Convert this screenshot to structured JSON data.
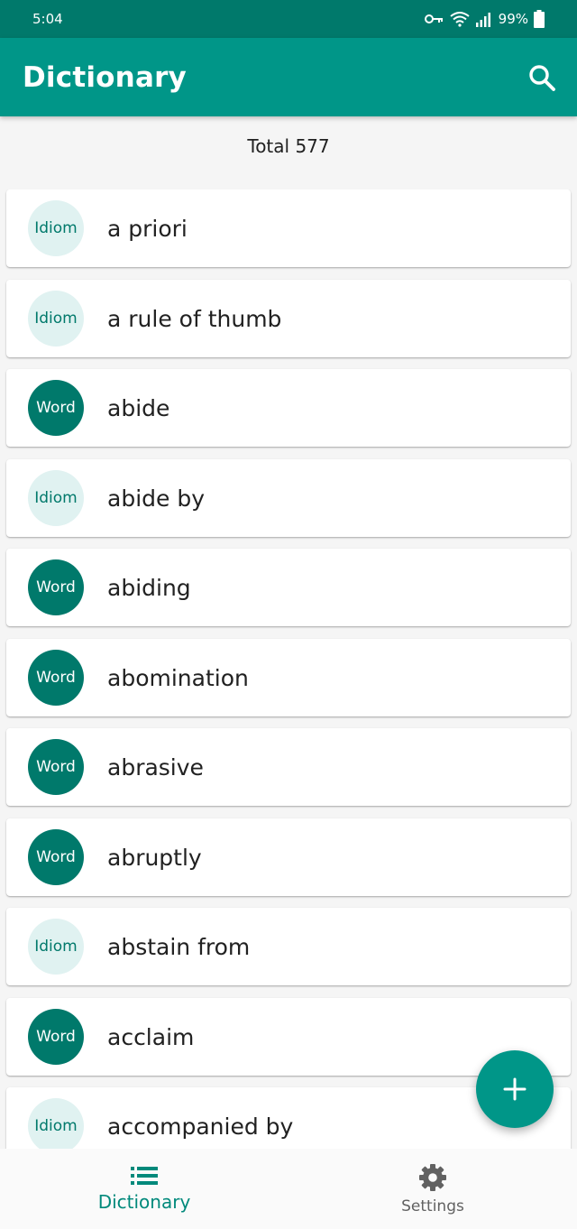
{
  "status_bar": {
    "time": "5:04",
    "battery": "99%"
  },
  "app_bar": {
    "title": "Dictionary",
    "search_icon": "search-icon"
  },
  "summary": {
    "total_label": "Total 577"
  },
  "entries": [
    {
      "type": "Idiom",
      "term": "a priori"
    },
    {
      "type": "Idiom",
      "term": "a rule of thumb"
    },
    {
      "type": "Word",
      "term": "abide"
    },
    {
      "type": "Idiom",
      "term": "abide by"
    },
    {
      "type": "Word",
      "term": "abiding"
    },
    {
      "type": "Word",
      "term": "abomination"
    },
    {
      "type": "Word",
      "term": "abrasive"
    },
    {
      "type": "Word",
      "term": "abruptly"
    },
    {
      "type": "Idiom",
      "term": "abstain from"
    },
    {
      "type": "Word",
      "term": "acclaim"
    },
    {
      "type": "Idiom",
      "term": "accompanied by"
    }
  ],
  "fab": {
    "icon": "plus-icon"
  },
  "bottom_nav": {
    "items": [
      {
        "label": "Dictionary",
        "icon": "list-icon",
        "active": true
      },
      {
        "label": "Settings",
        "icon": "gear-icon",
        "active": false
      }
    ]
  },
  "colors": {
    "primary": "#009688",
    "primary_dark": "#00796b",
    "idiom_badge_bg": "#e0f2f1",
    "background": "#f5f5f5"
  }
}
